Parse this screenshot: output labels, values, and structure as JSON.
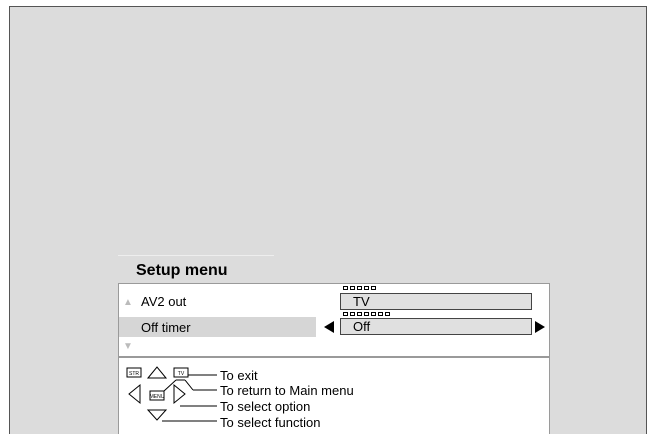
{
  "menu": {
    "title": "Setup menu",
    "rows": [
      {
        "label": "AV2 out",
        "value": "TV"
      },
      {
        "label": "Off timer",
        "value": "Off"
      }
    ]
  },
  "help": {
    "exit": "To exit",
    "return": "To return to Main menu",
    "select_option": "To select option",
    "select_function": "To select function",
    "key_str": "STR",
    "key_menu": "MENU",
    "key_tv": "TV"
  },
  "colors": {
    "background": "#dcdcdc",
    "panel": "#ffffff",
    "highlight": "#d6d6d6",
    "value_box": "#e0e0e0"
  },
  "icons": [
    "up-scroll-icon",
    "down-scroll-icon",
    "left-arrow-icon",
    "right-arrow-icon",
    "remote-keypad-icon"
  ]
}
